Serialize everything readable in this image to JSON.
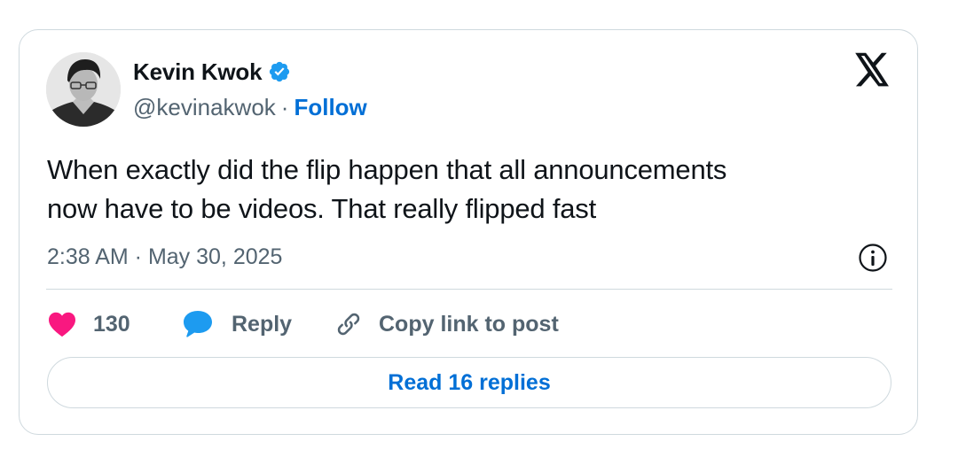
{
  "author": {
    "display_name": "Kevin Kwok",
    "handle": "@kevinakwok",
    "separator": "·",
    "follow_label": "Follow",
    "verified": true
  },
  "tweet": {
    "text": "When exactly did the flip happen that all announcements\nnow have to be videos. That really flipped fast",
    "timestamp": "2:38 AM · May 30, 2025"
  },
  "actions": {
    "like_count": "130",
    "reply_label": "Reply",
    "copy_label": "Copy link to post"
  },
  "read_replies_label": "Read 16 replies",
  "icons": {
    "brand": "x-logo-icon",
    "verified": "verified-badge-icon",
    "info": "info-icon",
    "like": "heart-icon",
    "reply": "speech-bubble-icon",
    "copy": "link-icon"
  },
  "colors": {
    "link_blue": "#006fd6",
    "verified_blue": "#1d9bf0",
    "heart_pink": "#f91880",
    "text": "#0f1419",
    "muted": "#536471",
    "border": "#cfd9de"
  }
}
